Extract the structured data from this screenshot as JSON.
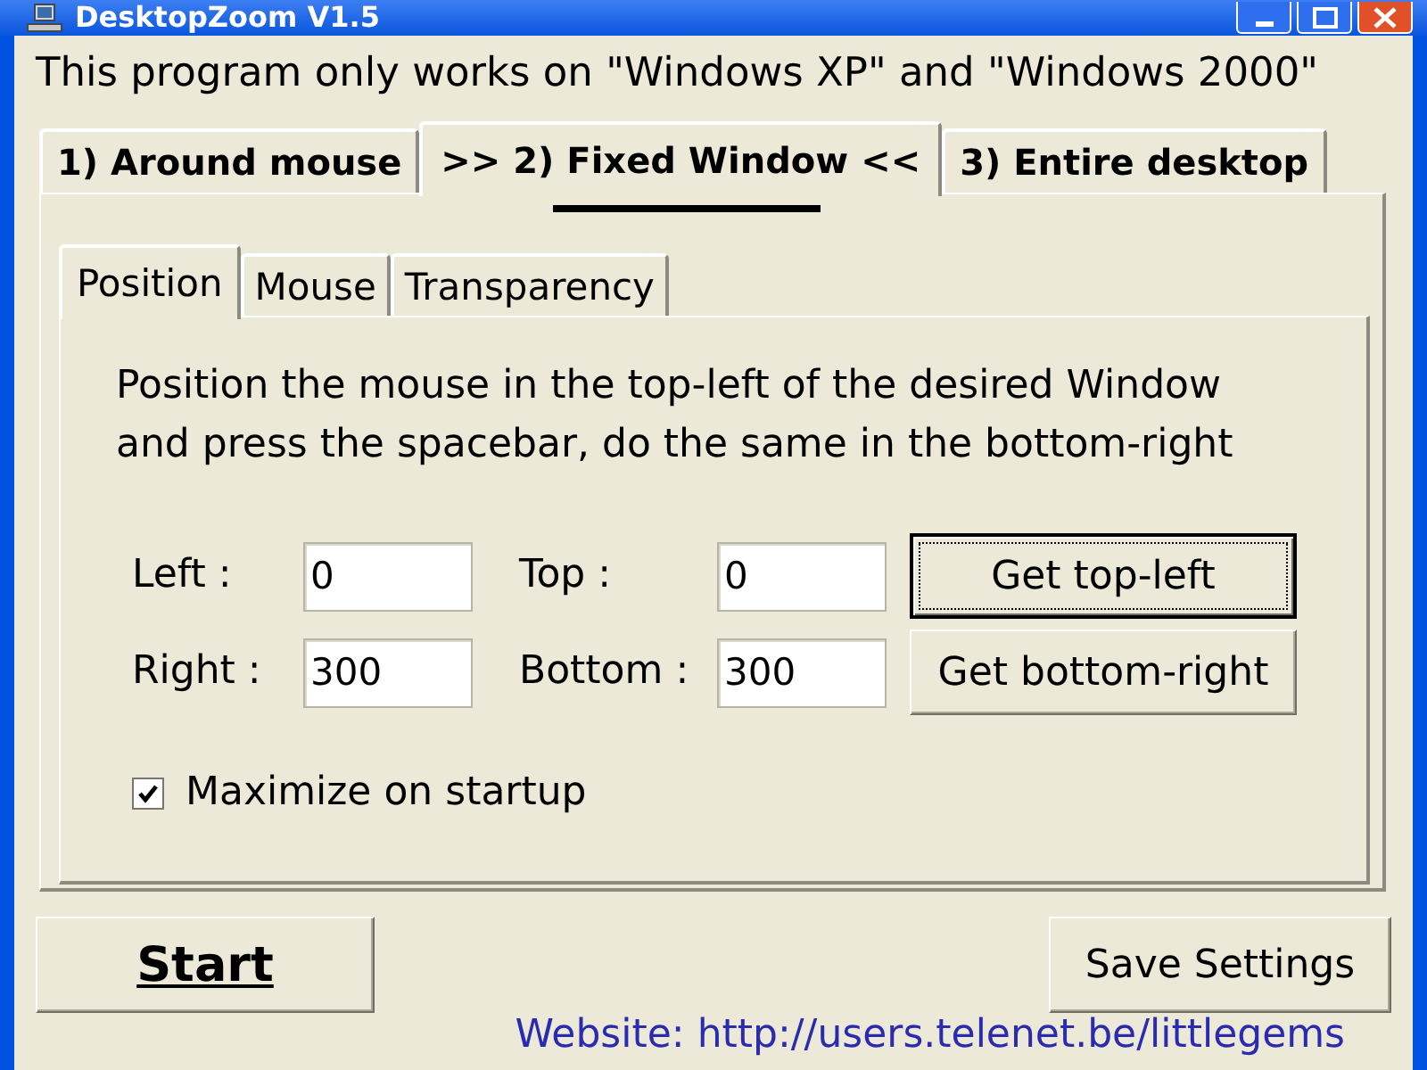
{
  "window": {
    "title": "DesktopZoom V1.5"
  },
  "notice": "This program only works on \"Windows XP\" and \"Windows 2000\"",
  "mode_tabs": [
    {
      "label": "1) Around mouse",
      "selected": false
    },
    {
      "label": ">> 2) Fixed Window <<",
      "selected": true
    },
    {
      "label": "3) Entire desktop",
      "selected": false
    }
  ],
  "sub_tabs": [
    {
      "label": "Position",
      "selected": true
    },
    {
      "label": "Mouse",
      "selected": false
    },
    {
      "label": "Transparency",
      "selected": false
    }
  ],
  "instructions": "Position the mouse in the top-left of the desired Window\nand press the spacebar, do the same in the bottom-right",
  "fields": [
    {
      "label": "Left :",
      "value": "0"
    },
    {
      "label": "Top :",
      "value": "0"
    },
    {
      "label": "Right :",
      "value": "300"
    },
    {
      "label": "Bottom :",
      "value": "300"
    }
  ],
  "capture_buttons": [
    {
      "label": "Get top-left",
      "default": true
    },
    {
      "label": "Get bottom-right",
      "default": false
    }
  ],
  "maximize_checkbox": {
    "label": "Maximize on startup",
    "checked": true
  },
  "start_button": {
    "label": "Start"
  },
  "save_button": {
    "label": "Save Settings"
  },
  "website": "Website: http://users.telenet.be/littlegems"
}
